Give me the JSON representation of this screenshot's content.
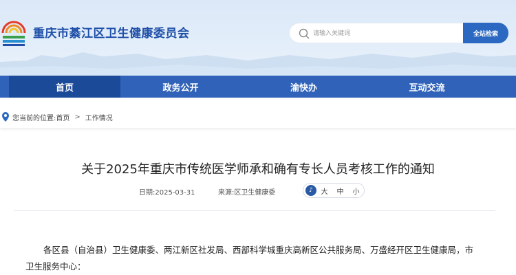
{
  "header": {
    "site_title": "重庆市綦江区卫生健康委员会",
    "logo_icon": "government-emblem-icon",
    "accent_color": "#2f62b8"
  },
  "search": {
    "placeholder": "请输入关键词",
    "button_label": "全站检索",
    "icon": "search-icon"
  },
  "nav": {
    "items": [
      {
        "label": "首页",
        "active": true
      },
      {
        "label": "政务公开"
      },
      {
        "label": "渝快办"
      },
      {
        "label": "互动交流"
      }
    ]
  },
  "breadcrumb": {
    "prefix": "您当前的位置:",
    "items": [
      "首页",
      "工作情况"
    ],
    "separator": ">",
    "icon": "location-pin-icon"
  },
  "article": {
    "title": "关于2025年重庆市传统医学师承和确有专长人员考核工作的通知",
    "date_label": "日期:",
    "date": "2025-03-31",
    "source_label": "来源:",
    "source": "区卫生健康委",
    "font_size_options": [
      "大",
      "中",
      "小"
    ],
    "body": "各区县（自治县）卫生健康委、两江新区社发局、西部科学城重庆高新区公共服务局、万盛经开区卫生健康局，市卫生服务中心："
  }
}
